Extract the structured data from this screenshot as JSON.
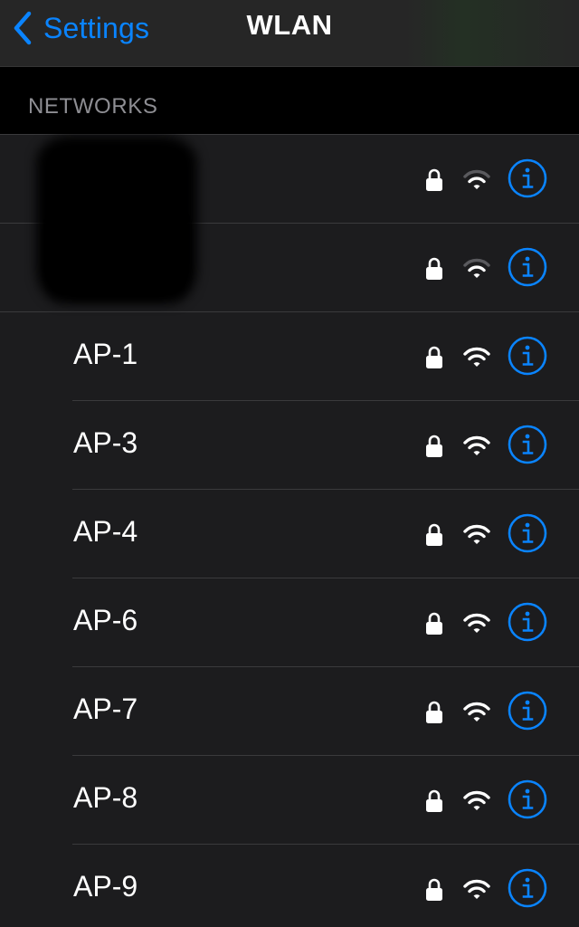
{
  "navbar": {
    "back_label": "Settings",
    "title": "WLAN",
    "accent_color": "#0a84ff"
  },
  "section": {
    "header": "NETWORKS"
  },
  "networks": [
    {
      "name": "",
      "secured": true,
      "signal": "weak",
      "redacted": true
    },
    {
      "name": "",
      "secured": true,
      "signal": "weak",
      "redacted": true
    },
    {
      "name": "AP-1",
      "secured": true,
      "signal": "full"
    },
    {
      "name": "AP-3",
      "secured": true,
      "signal": "full"
    },
    {
      "name": "AP-4",
      "secured": true,
      "signal": "full"
    },
    {
      "name": "AP-6",
      "secured": true,
      "signal": "full"
    },
    {
      "name": "AP-7",
      "secured": true,
      "signal": "full"
    },
    {
      "name": "AP-8",
      "secured": true,
      "signal": "full"
    },
    {
      "name": "AP-9",
      "secured": true,
      "signal": "full"
    }
  ],
  "icons": {
    "back": "chevron-left-icon",
    "lock": "lock-icon",
    "wifi": "wifi-icon",
    "info": "info-icon"
  }
}
